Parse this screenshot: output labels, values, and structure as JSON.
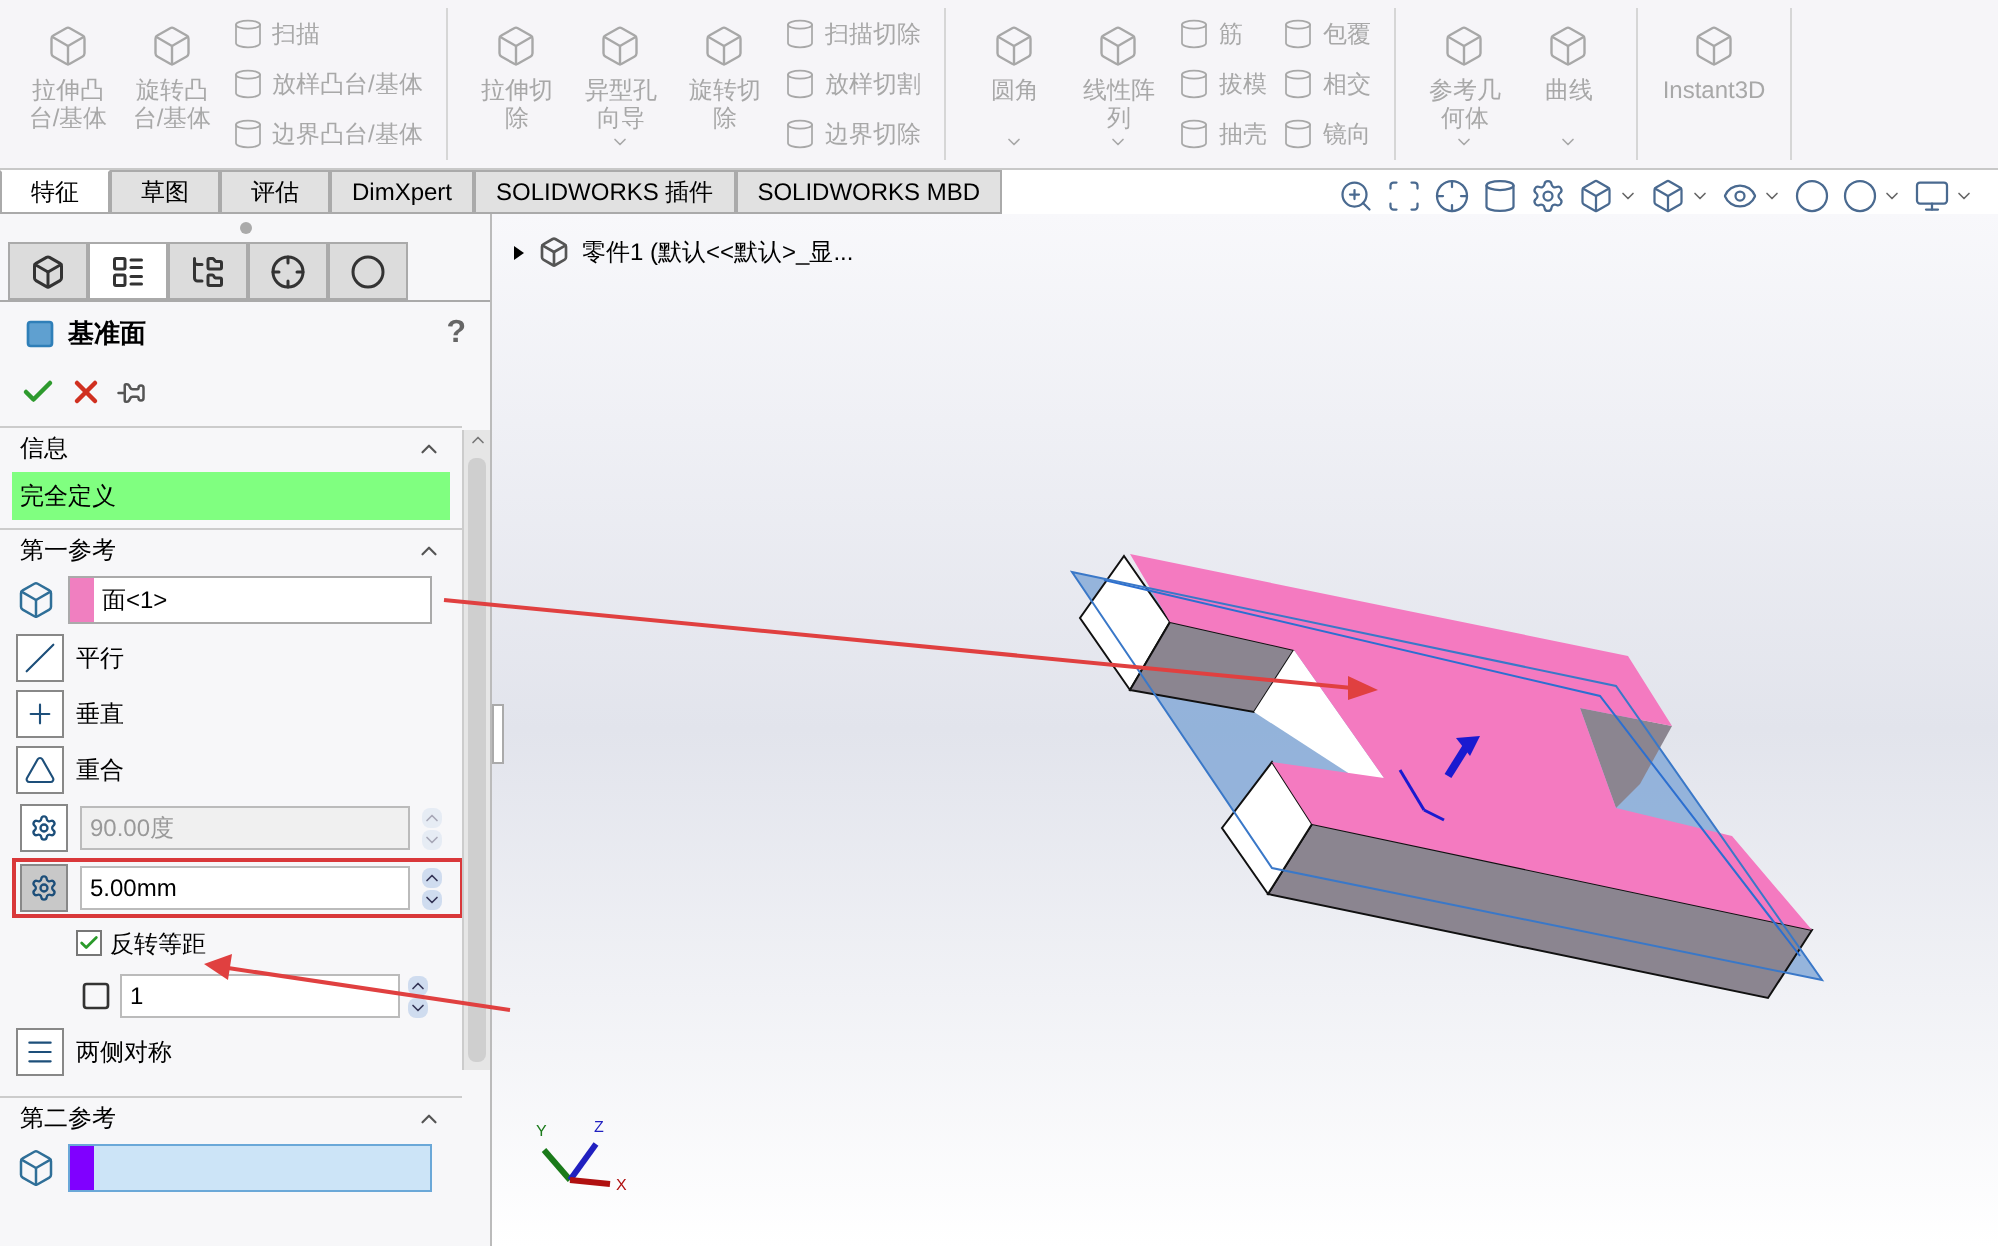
{
  "ribbon": {
    "groups": [
      {
        "columns": [
          {
            "kind": "large",
            "label": "拉伸凸台/基体",
            "dropdown": false
          },
          {
            "kind": "large",
            "label": "旋转凸台/基体",
            "dropdown": false
          },
          {
            "kind": "stack",
            "items": [
              {
                "label": "扫描"
              },
              {
                "label": "放样凸台/基体"
              },
              {
                "label": "边界凸台/基体"
              }
            ]
          }
        ]
      },
      {
        "columns": [
          {
            "kind": "large",
            "label": "拉伸切除",
            "dropdown": false
          },
          {
            "kind": "large",
            "label": "异型孔向导",
            "dropdown": true
          },
          {
            "kind": "large",
            "label": "旋转切除",
            "dropdown": false
          },
          {
            "kind": "stack",
            "items": [
              {
                "label": "扫描切除"
              },
              {
                "label": "放样切割"
              },
              {
                "label": "边界切除"
              }
            ]
          }
        ]
      },
      {
        "columns": [
          {
            "kind": "large",
            "label": "圆角",
            "dropdown": true
          },
          {
            "kind": "large",
            "label": "线性阵列",
            "dropdown": true
          },
          {
            "kind": "stack",
            "items": [
              {
                "label": "筋"
              },
              {
                "label": "拔模"
              },
              {
                "label": "抽壳"
              }
            ]
          },
          {
            "kind": "stack",
            "items": [
              {
                "label": "包覆"
              },
              {
                "label": "相交"
              },
              {
                "label": "镜向"
              }
            ]
          }
        ]
      },
      {
        "columns": [
          {
            "kind": "large",
            "label": "参考几何体",
            "dropdown": true
          },
          {
            "kind": "large",
            "label": "曲线",
            "dropdown": true
          }
        ]
      },
      {
        "columns": [
          {
            "kind": "wide",
            "label": "Instant3D",
            "dropdown": false
          }
        ]
      }
    ]
  },
  "tabs": [
    {
      "label": "特征",
      "selected": true
    },
    {
      "label": "草图",
      "selected": false
    },
    {
      "label": "评估",
      "selected": false
    },
    {
      "label": "DimXpert",
      "selected": false
    },
    {
      "label": "SOLIDWORKS 插件",
      "selected": false
    },
    {
      "label": "SOLIDWORKS MBD",
      "selected": false
    }
  ],
  "property_manager": {
    "tabs": [
      {
        "selected": false
      },
      {
        "selected": true
      },
      {
        "selected": false
      },
      {
        "selected": false
      },
      {
        "selected": false
      }
    ],
    "title": "基准面",
    "help": "?",
    "sections": [
      {
        "kind": "message",
        "title": "信息",
        "expanded": true,
        "message": "完全定义"
      },
      {
        "kind": "reference",
        "title": "第一参考",
        "expanded": true,
        "reference": {
          "value": "面<1>",
          "color": "#f07fc0",
          "active": false
        },
        "options": [
          {
            "kind": "option",
            "label": "平行"
          },
          {
            "kind": "option",
            "label": "垂直"
          },
          {
            "kind": "option",
            "label": "重合"
          },
          {
            "kind": "spin",
            "value": "90.00度",
            "disabled": true,
            "annotated": false
          },
          {
            "kind": "spin",
            "value": "5.00mm",
            "disabled": false,
            "annotated": true
          },
          {
            "kind": "checkbox",
            "label": "反转等距",
            "checked": true
          },
          {
            "kind": "count",
            "value": "1"
          },
          {
            "kind": "option",
            "label": "两侧对称"
          }
        ]
      },
      {
        "kind": "reference",
        "title": "第二参考",
        "expanded": true,
        "reference": {
          "color": "#8000ff",
          "active": true
        }
      }
    ]
  },
  "tree": {
    "label": "零件1 (默认<<默认>_显...",
    "expanded": false
  },
  "viewport": {
    "triad": {
      "x": "X",
      "y": "Y",
      "z": "Z"
    }
  }
}
